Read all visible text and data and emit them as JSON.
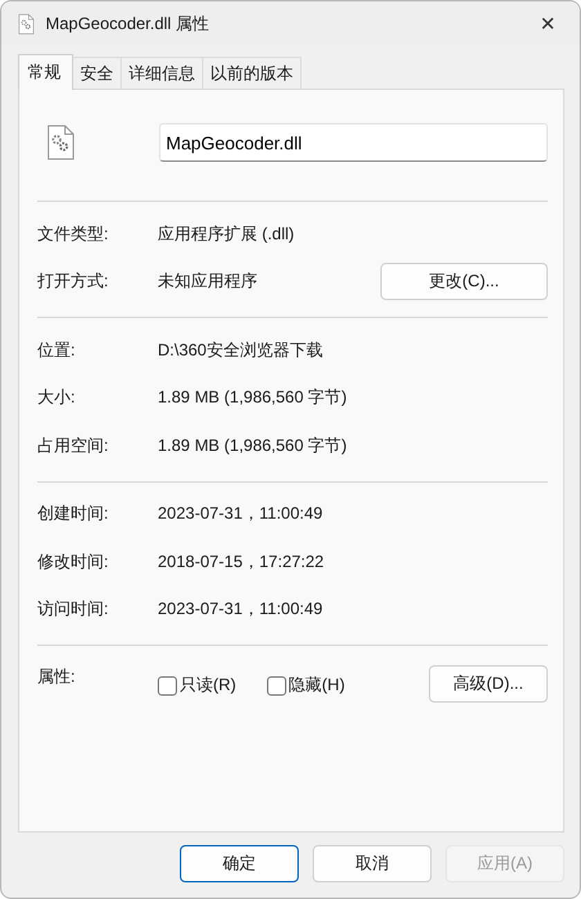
{
  "window": {
    "title": "MapGeocoder.dll 属性",
    "close": "✕"
  },
  "tabs": [
    {
      "label": "常规",
      "selected": true
    },
    {
      "label": "安全",
      "selected": false
    },
    {
      "label": "详细信息",
      "selected": false
    },
    {
      "label": "以前的版本",
      "selected": false
    }
  ],
  "file_name": "MapGeocoder.dll",
  "sections": [
    {
      "rows": [
        {
          "label": "文件类型:",
          "value": "应用程序扩展 (.dll)"
        },
        {
          "label": "打开方式:",
          "value": "未知应用程序",
          "button": "更改(C)..."
        }
      ]
    },
    {
      "rows": [
        {
          "label": "位置:",
          "value": "D:\\360安全浏览器下载"
        },
        {
          "label": "大小:",
          "value": "1.89 MB (1,986,560 字节)"
        },
        {
          "label": "占用空间:",
          "value": "1.89 MB (1,986,560 字节)"
        }
      ]
    },
    {
      "rows": [
        {
          "label": "创建时间:",
          "value": "2023-07-31，11:00:49"
        },
        {
          "label": "修改时间:",
          "value": "2018-07-15，17:27:22"
        },
        {
          "label": "访问时间:",
          "value": "2023-07-31，11:00:49"
        }
      ]
    }
  ],
  "attributes": {
    "label": "属性:",
    "checkboxes": [
      {
        "label": "只读(R)",
        "checked": false
      },
      {
        "label": "隐藏(H)",
        "checked": false
      }
    ],
    "button": "高级(D)..."
  },
  "buttons": [
    {
      "label": "确定",
      "default": true,
      "disabled": false
    },
    {
      "label": "取消",
      "default": false,
      "disabled": false
    },
    {
      "label": "应用(A)",
      "default": false,
      "disabled": true
    }
  ]
}
